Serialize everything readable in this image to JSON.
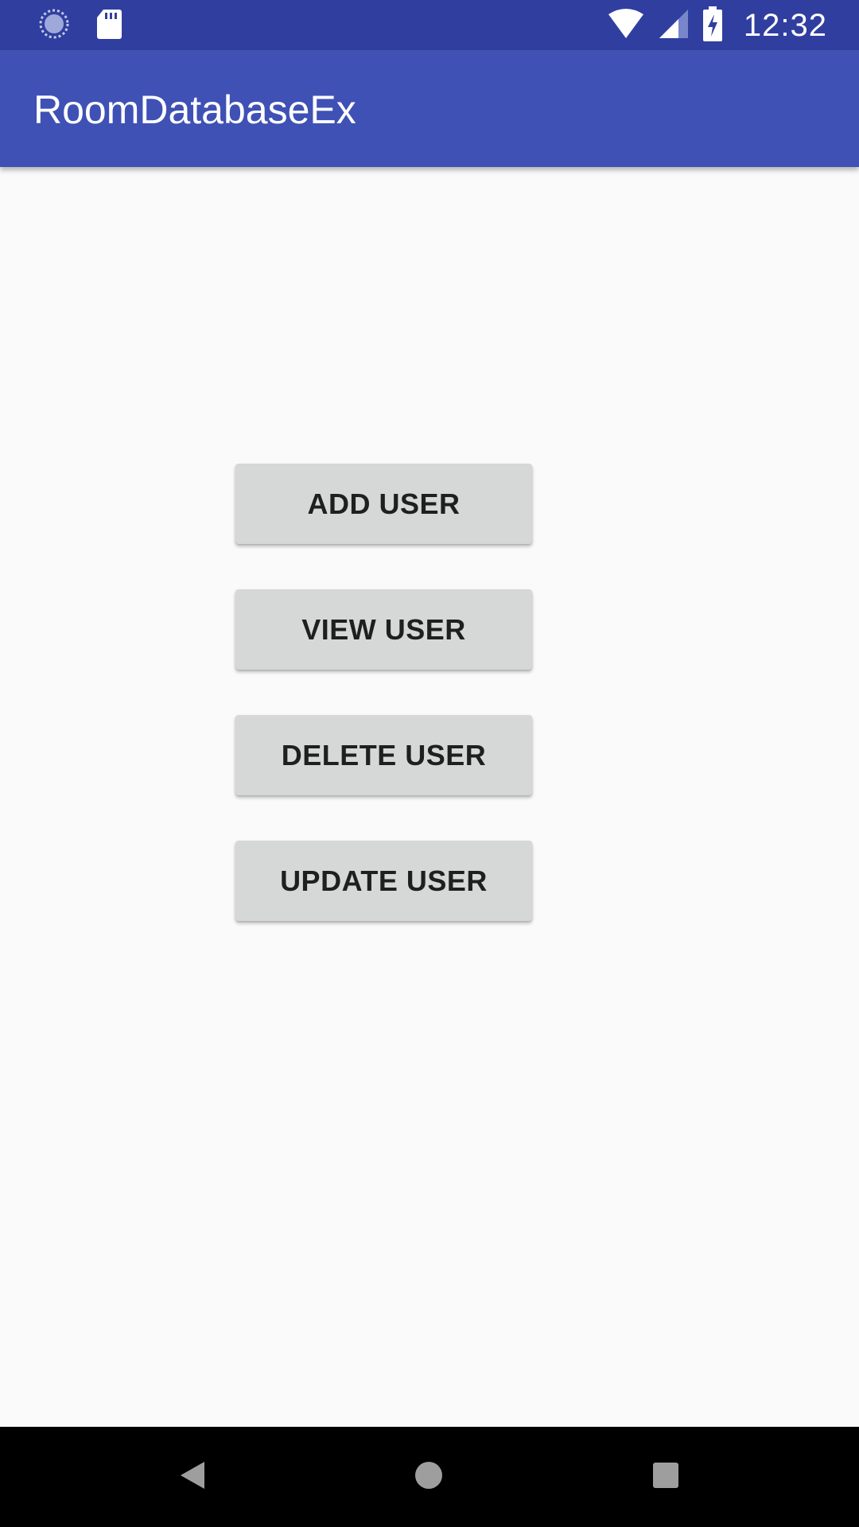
{
  "status_bar": {
    "time": "12:32",
    "icons": [
      "sync-icon",
      "sd-card-icon",
      "wifi-icon",
      "cell-signal-icon",
      "battery-charging-icon"
    ]
  },
  "app_bar": {
    "title": "RoomDatabaseEx"
  },
  "buttons": {
    "add": "ADD USER",
    "view": "VIEW USER",
    "delete": "DELETE USER",
    "update": "UPDATE USER"
  },
  "nav_bar": {
    "icons": [
      "back-icon",
      "home-icon",
      "recents-icon"
    ]
  },
  "colors": {
    "status_bar": "#303f9f",
    "app_bar": "#3f51b5",
    "background": "#fafafa",
    "button": "#d6d7d7",
    "button_text": "#1f1f1f",
    "nav_bar": "#000000"
  }
}
